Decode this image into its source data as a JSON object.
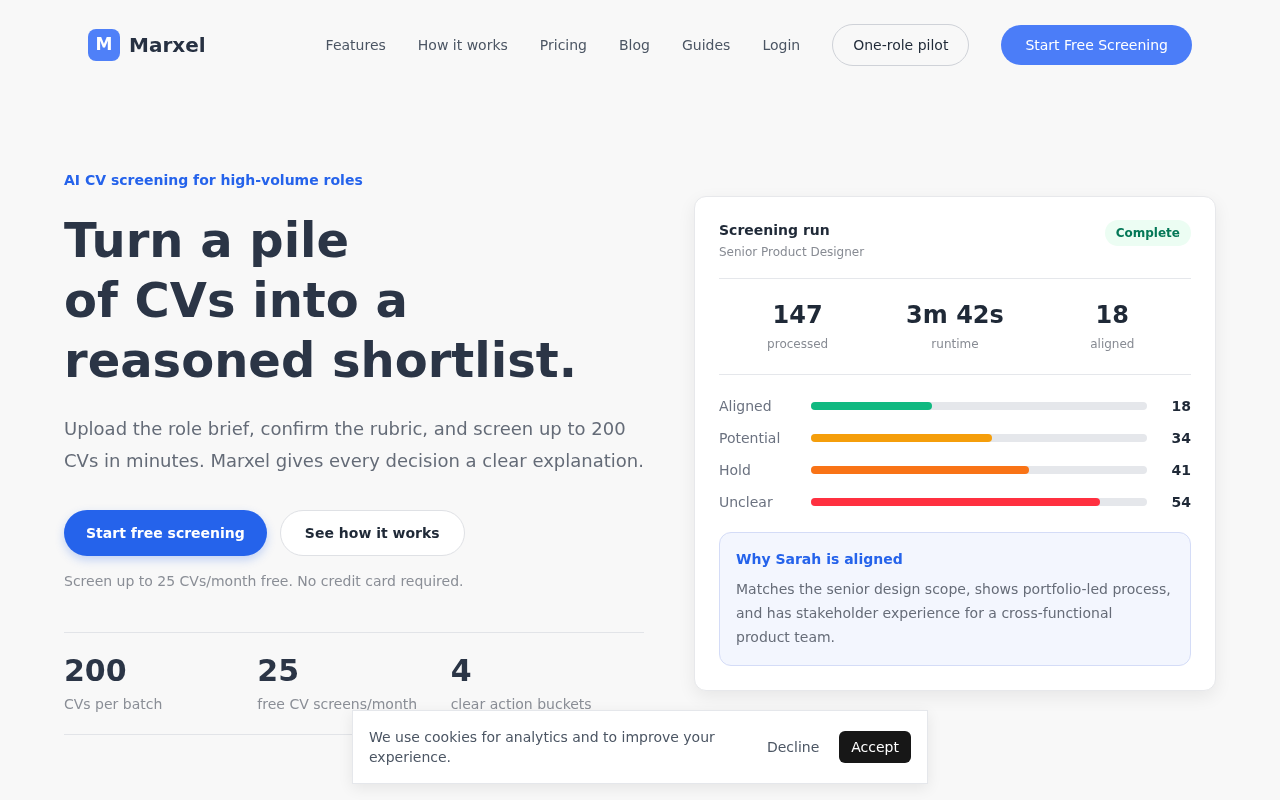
{
  "nav": {
    "logo": {
      "mark": "M",
      "name": "Marxel"
    },
    "links": [
      "Features",
      "How it works",
      "Pricing",
      "Blog",
      "Guides",
      "Login"
    ],
    "buttons": [
      {
        "label": "One-role pilot",
        "kind": "outline"
      },
      {
        "label": "Start Free Screening",
        "kind": "primary"
      }
    ]
  },
  "hero": {
    "eyebrow": "AI CV screening for high-volume roles",
    "headline_lines": [
      "Turn a pile",
      "of CVs into a",
      "reasoned shortlist."
    ],
    "description": "Upload the role brief, confirm the rubric, and screen up to 200 CVs in minutes. Marxel gives every decision a clear explanation.",
    "buttons": [
      {
        "label": "Start free screening",
        "kind": "primary"
      },
      {
        "label": "See how it works",
        "kind": "outline"
      }
    ],
    "note": "Screen up to 25 CVs/month free. No credit card required.",
    "stats": [
      {
        "value": "200",
        "label": "CVs per batch"
      },
      {
        "value": "25",
        "label": "free CV screens/month"
      },
      {
        "value": "4",
        "label": "clear action buckets"
      }
    ]
  },
  "screening_card": {
    "title": "Screening run",
    "subtitle": "Senior Product Designer",
    "status": "Complete",
    "stats": [
      {
        "value": "147",
        "label": "processed"
      },
      {
        "value": "3m 42s",
        "label": "runtime"
      },
      {
        "value": "18",
        "label": "aligned"
      }
    ],
    "buckets": [
      {
        "label": "Aligned",
        "level": 0.36,
        "count": "18",
        "color": "#10b981"
      },
      {
        "label": "Potential",
        "level": 0.54,
        "count": "34",
        "color": "#f59e0b"
      },
      {
        "label": "Hold",
        "level": 0.65,
        "count": "41",
        "color": "#f97316"
      },
      {
        "label": "Unclear",
        "level": 0.86,
        "count": "54",
        "color": "#ff3040"
      }
    ],
    "explanation": {
      "title": "Why Sarah is aligned",
      "text": "Matches the senior design scope, shows portfolio-led process, and has stakeholder experience for a cross-functional product team."
    }
  },
  "cookie_banner": {
    "text": "We use cookies for analytics and to improve your experience.",
    "buttons": [
      {
        "label": "Decline",
        "kind": "plain"
      },
      {
        "label": "Accept",
        "kind": "dark"
      }
    ]
  }
}
